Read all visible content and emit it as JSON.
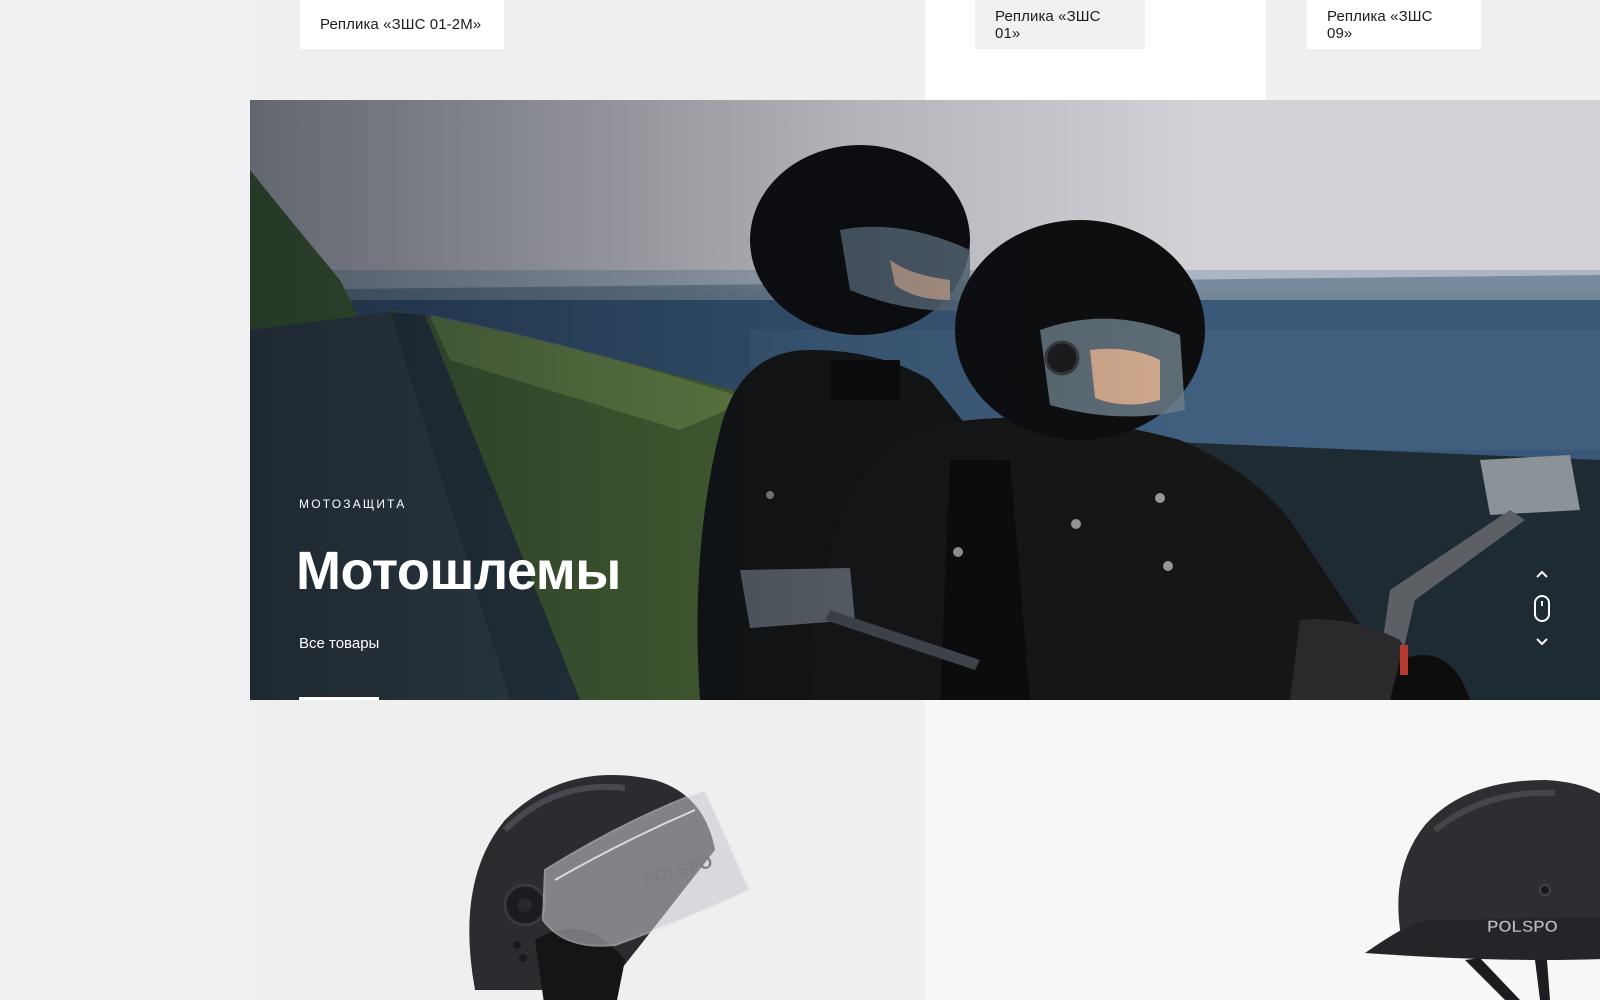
{
  "top_products": [
    {
      "label": "Реплика «ЗШС 01-2М»"
    },
    {
      "label": "Реплика «ЗШС 01»"
    },
    {
      "label": "Реплика «ЗШС 09»"
    }
  ],
  "hero": {
    "eyebrow": "МОТОЗАЩИТА",
    "title": "Мотошлемы",
    "link_label": "Все товары",
    "scroll": {
      "up_icon": "chevron-up-icon",
      "mouse_icon": "mouse-scroll-icon",
      "down_icon": "chevron-down-icon"
    }
  },
  "bottom_products": [
    {
      "image": "open-face-helmet-with-visor",
      "brand": "POLSPO"
    },
    {
      "image": "german-style-half-helmet",
      "brand": "POLSPO"
    }
  ],
  "colors": {
    "page_bg": "#f1f1f3",
    "tile_grey": "#efeff0",
    "tile_white": "#ffffff",
    "text_dark": "#1b1b1b",
    "hero_text": "#ffffff"
  }
}
